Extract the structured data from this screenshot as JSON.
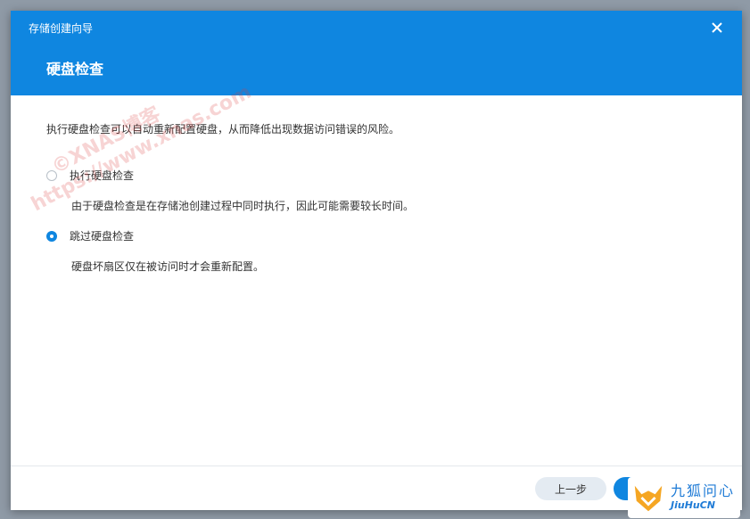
{
  "window": {
    "title": "存储创建向导"
  },
  "page": {
    "title": "硬盘检查"
  },
  "intro": "执行硬盘检查可以自动重新配置硬盘，从而降低出现数据访问错误的风险。",
  "options": [
    {
      "label": "执行硬盘检查",
      "description": "由于硬盘检查是在存储池创建过程中同时执行，因此可能需要较长时间。",
      "selected": false
    },
    {
      "label": "跳过硬盘检查",
      "description": "硬盘坏扇区仅在被访问时才会重新配置。",
      "selected": true
    }
  ],
  "footer": {
    "prev_label": "上一步",
    "next_label": ""
  },
  "watermark": {
    "line1": "©XNAS博客",
    "line2": "https://www.xnas.com"
  },
  "badge": {
    "cn": "九狐问心",
    "en": "JiuHuCN"
  },
  "colors": {
    "accent": "#0f86e0",
    "background": "#8f9aa6"
  }
}
